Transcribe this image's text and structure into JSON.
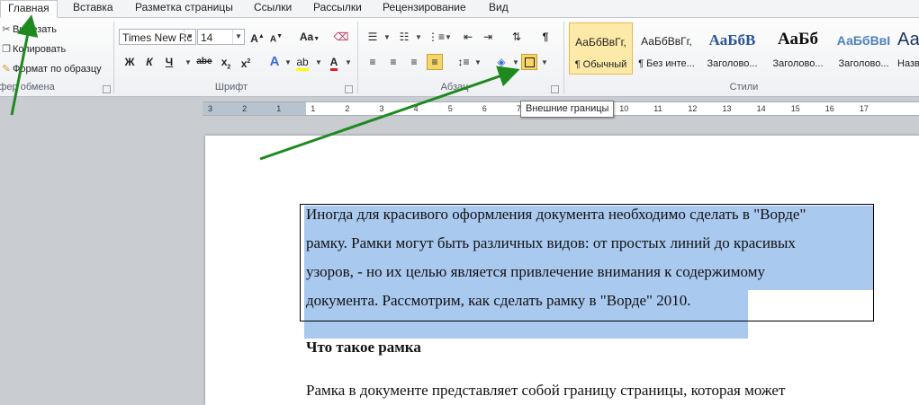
{
  "tabs": [
    "Главная",
    "Вставка",
    "Разметка страницы",
    "Ссылки",
    "Рассылки",
    "Рецензирование",
    "Вид"
  ],
  "clipboard": {
    "cut": "Вырезать",
    "copy": "Копировать",
    "format_painter": "Формат по образцу",
    "group_label": "Буфер обмена"
  },
  "font": {
    "name": "Times New Rc",
    "size": "14",
    "group_label": "Шрифт",
    "bold": "Ж",
    "italic": "К",
    "underline": "Ч",
    "strike": "abe",
    "grow": "A",
    "shrink": "A",
    "case": "Aa",
    "color": "A"
  },
  "paragraph": {
    "group_label": "Абзац"
  },
  "styles": {
    "group_label": "Стили",
    "items": [
      {
        "sample": "АаБбВвГг,",
        "name": "¶ Обычный"
      },
      {
        "sample": "АаБбВвГг,",
        "name": "¶ Без инте..."
      },
      {
        "sample": "АаБбВ",
        "name": "Заголово..."
      },
      {
        "sample": "АаБб",
        "name": "Заголово..."
      },
      {
        "sample": "АаБбВвI",
        "name": "Заголово..."
      },
      {
        "sample": "Аа",
        "name": "Назв"
      }
    ]
  },
  "tooltip": "Внешние границы",
  "ruler": [
    "3",
    "2",
    "1",
    "1",
    "2",
    "3",
    "4",
    "5",
    "6",
    "7",
    "8",
    "9",
    "10",
    "11",
    "12",
    "13",
    "14",
    "15",
    "16",
    "17"
  ],
  "document": {
    "paragraph_lines": [
      "Иногда для красивого оформления документа необходимо сделать в \"Ворде\"",
      "рамку. Рамки могут быть различных видов: от простых линий до красивых",
      "узоров, - но их целью является привлечение внимания к содержимому",
      "документа. Рассмотрим, как сделать рамку в \"Ворде\" 2010."
    ],
    "heading": "Что такое рамка",
    "next_line": "Рамка в документе представляет собой границу страницы, которая может"
  },
  "colors": {
    "selection": "#a9c9ef",
    "arrow": "#1e8a1e"
  }
}
